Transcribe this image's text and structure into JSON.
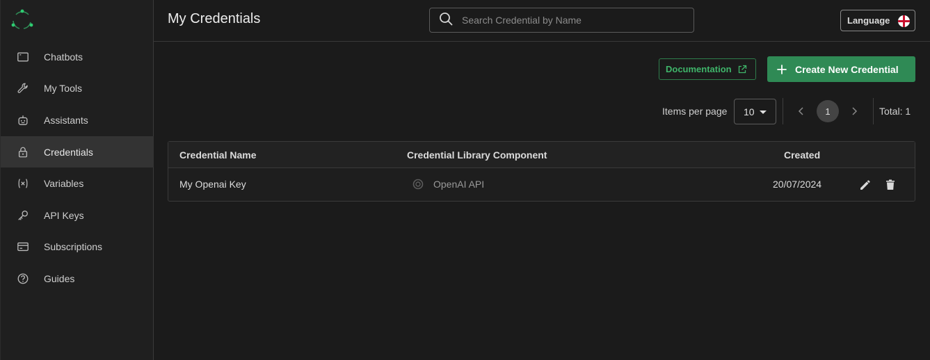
{
  "colors": {
    "accent": "#2f8a55",
    "accent_text": "#3fb56a",
    "logo_dot": "#2ecc71"
  },
  "sidebar": {
    "logo": "app-logo",
    "items": [
      {
        "label": "Chatbots",
        "icon": "window-icon",
        "active": false
      },
      {
        "label": "My Tools",
        "icon": "wrench-icon",
        "active": false
      },
      {
        "label": "Assistants",
        "icon": "robot-icon",
        "active": false
      },
      {
        "label": "Credentials",
        "icon": "lock-icon",
        "active": true
      },
      {
        "label": "Variables",
        "icon": "variable-icon",
        "active": false
      },
      {
        "label": "API Keys",
        "icon": "key-icon",
        "active": false
      },
      {
        "label": "Subscriptions",
        "icon": "credit-card-icon",
        "active": false
      },
      {
        "label": "Guides",
        "icon": "help-circle-icon",
        "active": false
      }
    ]
  },
  "header": {
    "title": "My Credentials",
    "search_placeholder": "Search Credential by Name",
    "language_label": "Language",
    "language_flag": "england-flag-icon"
  },
  "actions": {
    "documentation_label": "Documentation",
    "create_label": "Create New Credential"
  },
  "pagination": {
    "items_per_page_label": "Items per page",
    "items_per_page_value": "10",
    "current_page": "1",
    "total_label": "Total: 1"
  },
  "table": {
    "columns": [
      "Credential Name",
      "Credential Library Component",
      "Created"
    ],
    "rows": [
      {
        "name": "My Openai Key",
        "component": "OpenAI API",
        "component_icon": "openai-icon",
        "created": "20/07/2024"
      }
    ]
  }
}
